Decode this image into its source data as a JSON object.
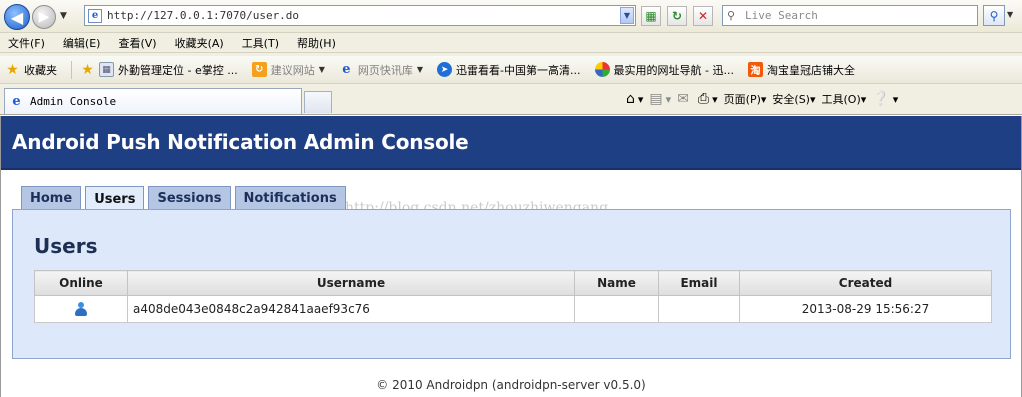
{
  "browser": {
    "url": "http://127.0.0.1:7070/user.do",
    "search_placeholder": "Live Search",
    "menu": [
      "文件(F)",
      "编辑(E)",
      "查看(V)",
      "收藏夹(A)",
      "工具(T)",
      "帮助(H)"
    ],
    "favorites_label": "收藏夹",
    "favorites": [
      {
        "label": "外勤管理定位 - e掌控 ...",
        "icon": "image-icon"
      },
      {
        "label": "建议网站",
        "icon": "suggested-sites-icon",
        "dropdown": true
      },
      {
        "label": "网页快讯库",
        "icon": "web-slice-icon",
        "dropdown": true
      },
      {
        "label": "迅雷看看-中国第一高清...",
        "icon": "xunlei-icon"
      },
      {
        "label": "最实用的网址导航 - 迅...",
        "icon": "nav-icon"
      },
      {
        "label": "淘宝皇冠店铺大全",
        "icon": "taobao-icon"
      }
    ],
    "tab_title": "Admin Console",
    "commands": {
      "page": "页面(P)",
      "safety": "安全(S)",
      "tools": "工具(O)"
    }
  },
  "app": {
    "title": "Android Push Notification Admin Console",
    "tabs": [
      "Home",
      "Users",
      "Sessions",
      "Notifications"
    ],
    "active_tab": "Users",
    "watermark": "http://blog.csdn.net/zhouzhiwengang",
    "section_title": "Users",
    "table": {
      "headers": [
        "Online",
        "Username",
        "Name",
        "Email",
        "Created"
      ],
      "rows": [
        {
          "online_icon": "user-online-icon",
          "username": "a408de043e0848c2a942841aaef93c76",
          "name": "",
          "email": "",
          "created": "2013-08-29 15:56:27"
        }
      ]
    },
    "footer": "© 2010 Androidpn (androidpn-server v0.5.0)"
  },
  "colors": {
    "header_bg": "#1f3f85",
    "tab_bg": "#b4c6e4",
    "tab_active_bg": "#e2ecfb",
    "panel_bg": "#dde9fb"
  }
}
